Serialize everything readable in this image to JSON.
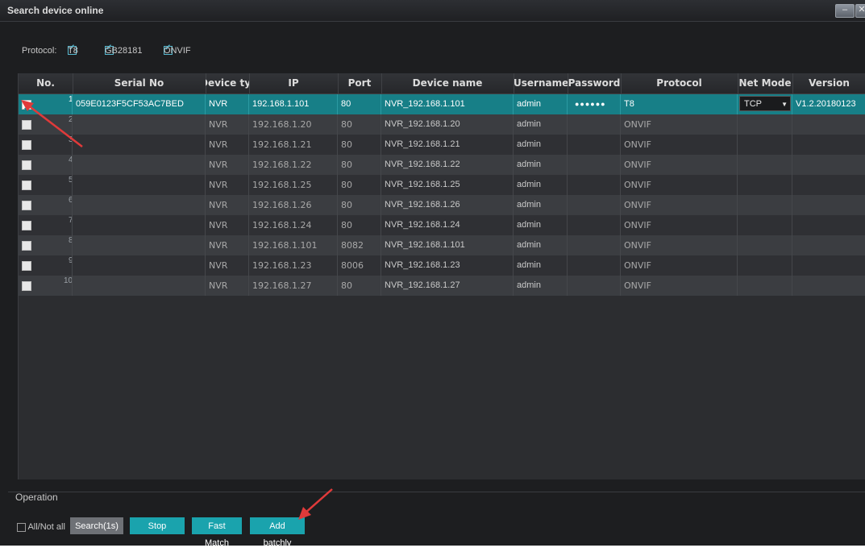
{
  "window": {
    "title": "Search device online"
  },
  "protocol_filter": {
    "label": "Protocol:",
    "options": [
      {
        "label": "T8",
        "checked": true
      },
      {
        "label": "GB28181",
        "checked": true
      },
      {
        "label": "ONVIF",
        "checked": true
      }
    ]
  },
  "table": {
    "columns": [
      "No.",
      "Serial No",
      "Device type",
      "IP",
      "Port",
      "Device name",
      "Username",
      "Password",
      "Protocol",
      "Net Mode",
      "Version"
    ],
    "rows": [
      {
        "no": "1",
        "checked": true,
        "serial": "059E0123F5CF53AC7BED",
        "type": "NVR",
        "ip": "192.168.1.101",
        "port": "80",
        "name": "NVR_192.168.1.101",
        "user": "admin",
        "password": "●●●●●●",
        "protocol": "T8",
        "netmode": "TCP",
        "version": "V1.2.20180123"
      },
      {
        "no": "2",
        "checked": false,
        "serial": "",
        "type": "NVR",
        "ip": "192.168.1.20",
        "port": "80",
        "name": "NVR_192.168.1.20",
        "user": "admin",
        "password": "",
        "protocol": "ONVIF",
        "netmode": "",
        "version": ""
      },
      {
        "no": "3",
        "checked": false,
        "serial": "",
        "type": "NVR",
        "ip": "192.168.1.21",
        "port": "80",
        "name": "NVR_192.168.1.21",
        "user": "admin",
        "password": "",
        "protocol": "ONVIF",
        "netmode": "",
        "version": ""
      },
      {
        "no": "4",
        "checked": false,
        "serial": "",
        "type": "NVR",
        "ip": "192.168.1.22",
        "port": "80",
        "name": "NVR_192.168.1.22",
        "user": "admin",
        "password": "",
        "protocol": "ONVIF",
        "netmode": "",
        "version": ""
      },
      {
        "no": "5",
        "checked": false,
        "serial": "",
        "type": "NVR",
        "ip": "192.168.1.25",
        "port": "80",
        "name": "NVR_192.168.1.25",
        "user": "admin",
        "password": "",
        "protocol": "ONVIF",
        "netmode": "",
        "version": ""
      },
      {
        "no": "6",
        "checked": false,
        "serial": "",
        "type": "NVR",
        "ip": "192.168.1.26",
        "port": "80",
        "name": "NVR_192.168.1.26",
        "user": "admin",
        "password": "",
        "protocol": "ONVIF",
        "netmode": "",
        "version": ""
      },
      {
        "no": "7",
        "checked": false,
        "serial": "",
        "type": "NVR",
        "ip": "192.168.1.24",
        "port": "80",
        "name": "NVR_192.168.1.24",
        "user": "admin",
        "password": "",
        "protocol": "ONVIF",
        "netmode": "",
        "version": ""
      },
      {
        "no": "8",
        "checked": false,
        "serial": "",
        "type": "NVR",
        "ip": "192.168.1.101",
        "port": "8082",
        "name": "NVR_192.168.1.101",
        "user": "admin",
        "password": "",
        "protocol": "ONVIF",
        "netmode": "",
        "version": ""
      },
      {
        "no": "9",
        "checked": false,
        "serial": "",
        "type": "NVR",
        "ip": "192.168.1.23",
        "port": "8006",
        "name": "NVR_192.168.1.23",
        "user": "admin",
        "password": "",
        "protocol": "ONVIF",
        "netmode": "",
        "version": ""
      },
      {
        "no": "10",
        "checked": false,
        "serial": "",
        "type": "NVR",
        "ip": "192.168.1.27",
        "port": "80",
        "name": "NVR_192.168.1.27",
        "user": "admin",
        "password": "",
        "protocol": "ONVIF",
        "netmode": "",
        "version": ""
      }
    ]
  },
  "operation": {
    "label": "Operation",
    "all_not_all": "All/Not all",
    "buttons": {
      "search": "Search(1s)",
      "stop": "Stop",
      "fast_match": "Fast Match",
      "add_batchly": "Add batchly"
    }
  },
  "colors": {
    "selected_row": "#177f87",
    "accent_button": "#1aa3ad",
    "annotation_arrow": "#e03a3a"
  }
}
